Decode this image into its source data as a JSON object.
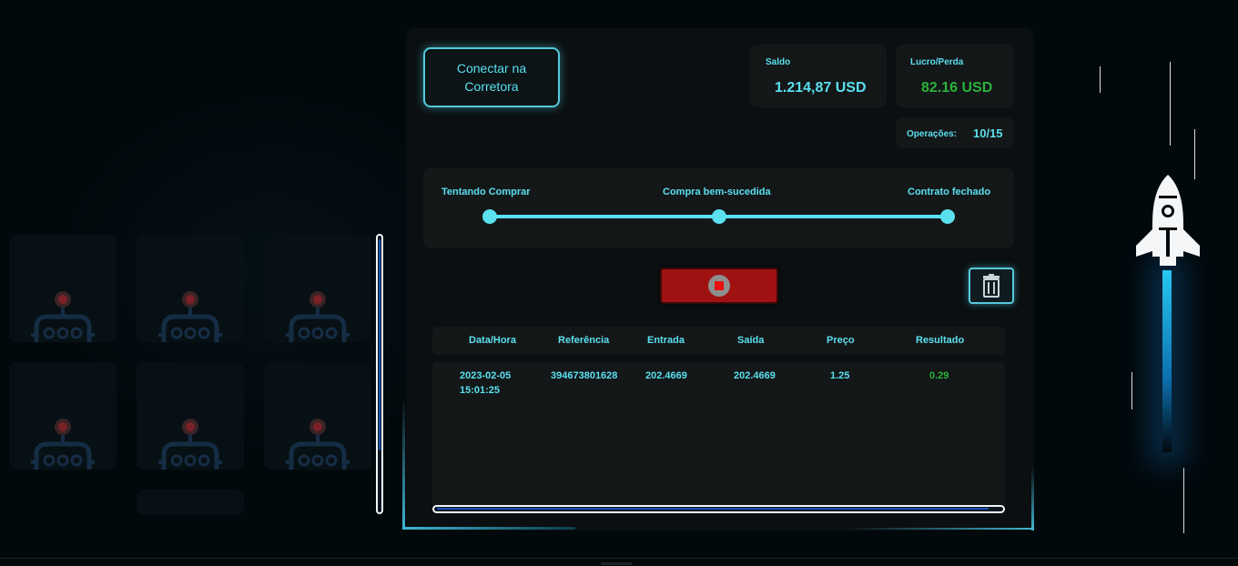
{
  "robots": {
    "icon": "robot-icon",
    "count": 6
  },
  "connect_button": {
    "label": "Conectar na Corretora"
  },
  "stats": {
    "saldo_label": "Saldo",
    "saldo_value": "1.214,87 USD",
    "lucro_label": "Lucro/Perda",
    "lucro_value": "82.16 USD",
    "operacoes_label": "Operações:",
    "operacoes_value": "10/15"
  },
  "progress": {
    "steps": [
      {
        "label": "Tentando Comprar"
      },
      {
        "label": "Compra bem-sucedida"
      },
      {
        "label": "Contrato fechado"
      }
    ]
  },
  "controls": {
    "stop_icon": "stop-icon",
    "trash_icon": "trash-icon"
  },
  "table": {
    "columns": [
      "Data/Hora",
      "Referência",
      "Entrada",
      "Saída",
      "Preço",
      "Resultado"
    ],
    "rows": [
      {
        "data_hora_date": "2023-02-05",
        "data_hora_time": "15:01:25",
        "referencia": "394673801628",
        "entrada": "202.4669",
        "saida": "202.4669",
        "preco": "1.25",
        "resultado": "0.29"
      }
    ]
  },
  "colors": {
    "accent": "#5ae0ef",
    "positive": "#29b33a",
    "stop": "#a01212"
  }
}
